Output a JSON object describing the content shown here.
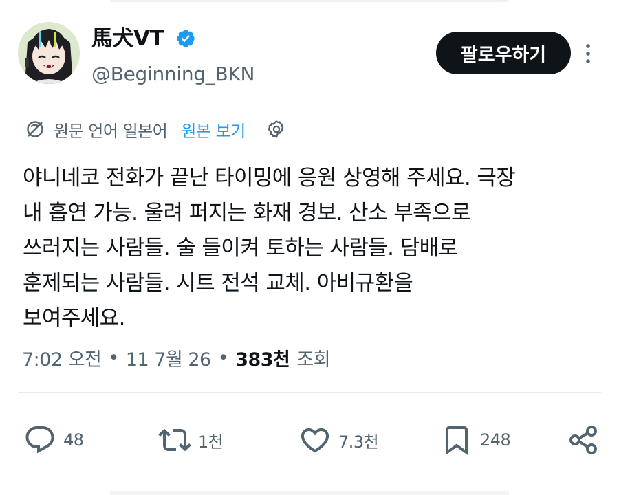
{
  "author": {
    "display_name": "馬犬VT",
    "handle": "@Beginning_BKN",
    "verified": true,
    "avatar_icon": "vtuber-avatar"
  },
  "header": {
    "follow_label": "팔로우하기",
    "more_icon": "more-vertical-icon"
  },
  "translation": {
    "icon": "translate-icon",
    "label": "원문 언어 일본어",
    "link_label": "원본 보기",
    "settings_icon": "gear-icon"
  },
  "tweet": {
    "text": "야니네코 전화가 끝난 타이밍에 응원 상영해 주세요. 극장\n내 흡연 가능. 울려 퍼지는 화재 경보. 산소 부족으로\n쓰러지는 사람들. 술 들이켜 토하는 사람들. 담배로\n훈제되는 사람들. 시트 전석 교체. 아비규환을\n보여주세요."
  },
  "meta": {
    "time": "7:02 오전",
    "separator": "•",
    "date": "11 7월 26",
    "views_count": "383천",
    "views_label": "조회"
  },
  "actions": {
    "reply": {
      "icon": "reply-icon",
      "count": "48"
    },
    "retweet": {
      "icon": "retweet-icon",
      "count": "1천"
    },
    "like": {
      "icon": "heart-icon",
      "count": "7.3천"
    },
    "bookmark": {
      "icon": "bookmark-icon",
      "count": "248"
    },
    "share": {
      "icon": "share-icon"
    }
  },
  "colors": {
    "text_primary": "#0f1419",
    "text_secondary": "#536471",
    "link": "#1d9bf0",
    "verified_badge": "#1d9bf0",
    "button_bg": "#0f1419",
    "button_text": "#ffffff"
  }
}
